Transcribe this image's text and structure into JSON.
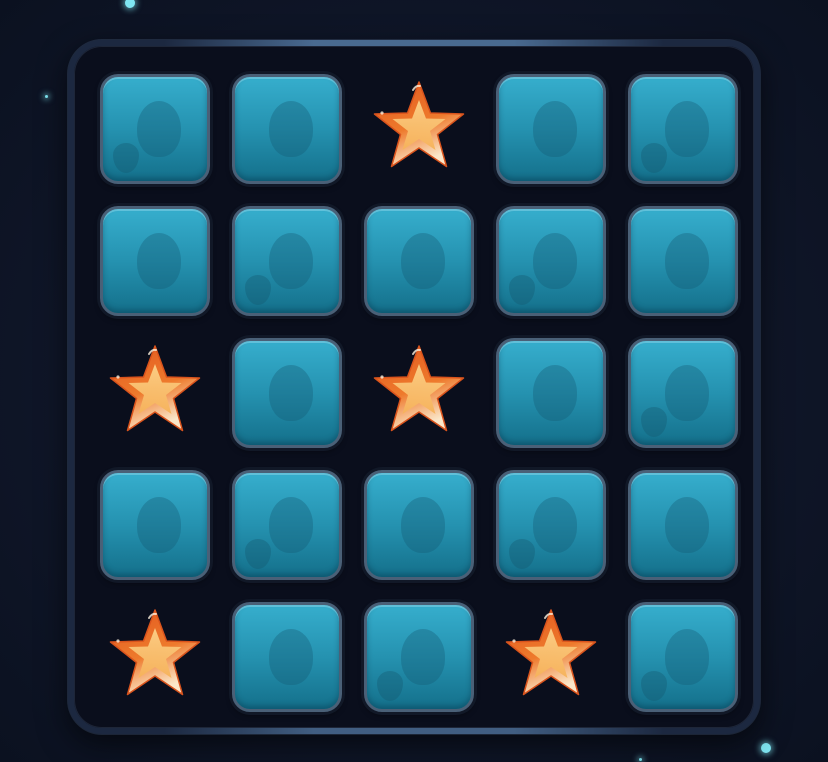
{
  "game": {
    "grid": {
      "rows": 5,
      "cols": 5,
      "cells": [
        [
          "tile",
          "tile",
          "star",
          "tile",
          "tile"
        ],
        [
          "tile",
          "tile",
          "tile",
          "tile",
          "tile"
        ],
        [
          "star",
          "tile",
          "star",
          "tile",
          "tile"
        ],
        [
          "tile",
          "tile",
          "tile",
          "tile",
          "tile"
        ],
        [
          "star",
          "tile",
          "tile",
          "star",
          "tile"
        ]
      ]
    },
    "tile_icon": "hidden-tile",
    "revealed_icon": "star-icon",
    "colors": {
      "background": "#0f1628",
      "board": "#0a0e1c",
      "board_border": "#1c2840",
      "tile_top": "#36aecd",
      "tile_bottom": "#14708b",
      "tile_border": "#4a6077",
      "star_outer": "#e2571f",
      "star_inner": "#f6b25a",
      "particle": "#7fe6f2"
    }
  }
}
